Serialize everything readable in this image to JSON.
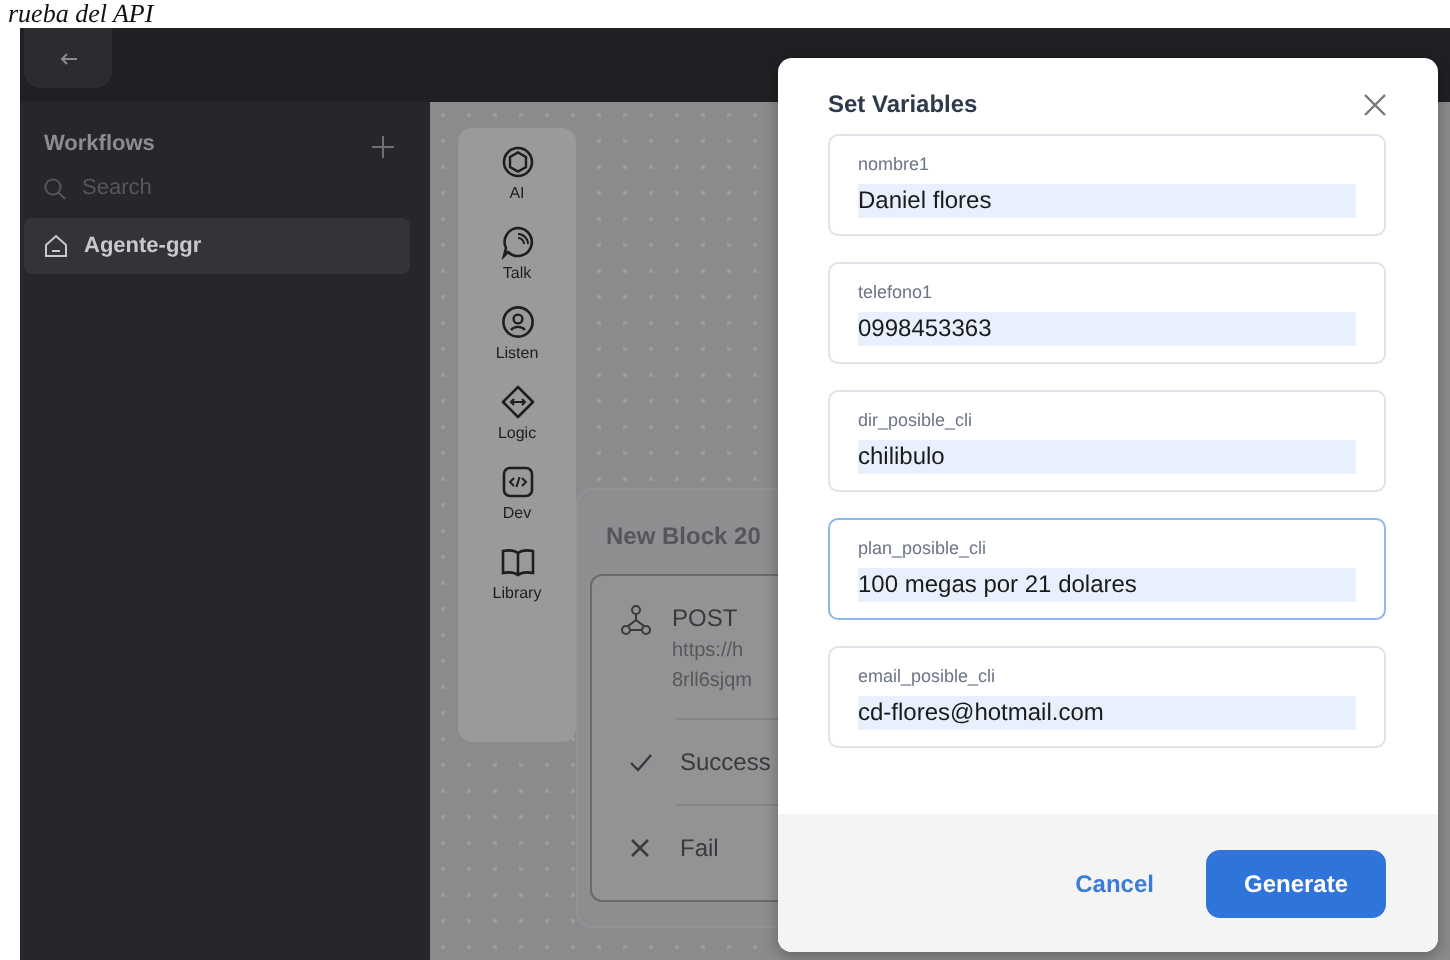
{
  "page_heading": "rueba del API",
  "sidebar": {
    "title": "Workflows",
    "search": {
      "placeholder": "Search"
    },
    "items": [
      {
        "label": "Agente-ggr",
        "selected": true
      }
    ]
  },
  "toolbox": [
    {
      "label": "AI",
      "kind": "ai"
    },
    {
      "label": "Talk",
      "kind": "talk"
    },
    {
      "label": "Listen",
      "kind": "listen"
    },
    {
      "label": "Logic",
      "kind": "logic"
    },
    {
      "label": "Dev",
      "kind": "dev"
    },
    {
      "label": "Library",
      "kind": "library"
    }
  ],
  "block": {
    "title": "New Block 20",
    "method": "POST",
    "url_lines": [
      "https://h",
      "8rll6sjqm"
    ],
    "outcomes": [
      {
        "label": "Success",
        "kind": "success"
      },
      {
        "label": "Fail",
        "kind": "fail"
      }
    ]
  },
  "dialog": {
    "title": "Set Variables",
    "fields": [
      {
        "label": "nombre1",
        "value": "Daniel flores",
        "focused": false
      },
      {
        "label": "telefono1",
        "value": "0998453363",
        "focused": false
      },
      {
        "label": "dir_posible_cli",
        "value": "chilibulo",
        "focused": false
      },
      {
        "label": "plan_posible_cli",
        "value": "100 megas por 21 dolares",
        "focused": true
      },
      {
        "label": "email_posible_cli",
        "value": "cd-flores@hotmail.com",
        "focused": false
      }
    ],
    "buttons": [
      {
        "label": "Cancel",
        "kind": "link"
      },
      {
        "label": "Generate",
        "kind": "primary"
      }
    ]
  }
}
